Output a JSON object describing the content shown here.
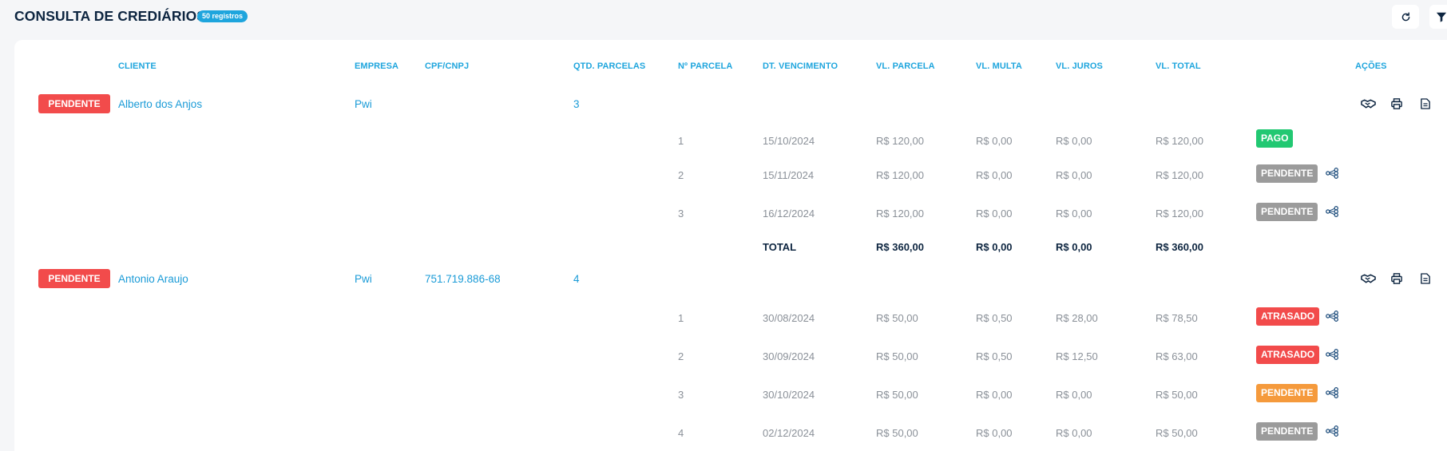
{
  "page": {
    "title": "CONSULTA DE CREDIÁRIOS",
    "records_badge": "50 registros"
  },
  "toolbar": {
    "refresh_icon": "refresh-icon",
    "filter_icon": "filter-icon"
  },
  "table": {
    "headers": {
      "cliente": "CLIENTE",
      "empresa": "EMPRESA",
      "cpf": "CPF/CNPJ",
      "qtd": "QTD. PARCELAS",
      "nparcela": "Nº PARCELA",
      "vencimento": "DT. VENCIMENTO",
      "vl_parcela": "VL. PARCELA",
      "vl_multa": "VL. MULTA",
      "vl_juros": "VL. JUROS",
      "vl_total": "VL. TOTAL",
      "acoes": "AÇÕES"
    },
    "groups": [
      {
        "status": "PENDENTE",
        "cliente": "Alberto dos Anjos",
        "empresa": "Pwi",
        "cpf": "",
        "qtd": "3",
        "parcelas": [
          {
            "n": "1",
            "vencimento": "15/10/2024",
            "vl_parcela": "R$ 120,00",
            "vl_multa": "R$ 0,00",
            "vl_juros": "R$ 0,00",
            "vl_total": "R$ 120,00",
            "status": "PAGO"
          },
          {
            "n": "2",
            "vencimento": "15/11/2024",
            "vl_parcela": "R$ 120,00",
            "vl_multa": "R$ 0,00",
            "vl_juros": "R$ 0,00",
            "vl_total": "R$ 120,00",
            "status": "PENDENTE"
          },
          {
            "n": "3",
            "vencimento": "16/12/2024",
            "vl_parcela": "R$ 120,00",
            "vl_multa": "R$ 0,00",
            "vl_juros": "R$ 0,00",
            "vl_total": "R$ 120,00",
            "status": "PENDENTE"
          }
        ],
        "total": {
          "label": "TOTAL",
          "vl_parcela": "R$ 360,00",
          "vl_multa": "R$ 0,00",
          "vl_juros": "R$ 0,00",
          "vl_total": "R$ 360,00"
        }
      },
      {
        "status": "PENDENTE",
        "cliente": "Antonio Araujo",
        "empresa": "Pwi",
        "cpf": "751.719.886-68",
        "qtd": "4",
        "parcelas": [
          {
            "n": "1",
            "vencimento": "30/08/2024",
            "vl_parcela": "R$ 50,00",
            "vl_multa": "R$ 0,50",
            "vl_juros": "R$ 28,00",
            "vl_total": "R$ 78,50",
            "status": "ATRASADO"
          },
          {
            "n": "2",
            "vencimento": "30/09/2024",
            "vl_parcela": "R$ 50,00",
            "vl_multa": "R$ 0,50",
            "vl_juros": "R$ 12,50",
            "vl_total": "R$ 63,00",
            "status": "ATRASADO"
          },
          {
            "n": "3",
            "vencimento": "30/10/2024",
            "vl_parcela": "R$ 50,00",
            "vl_multa": "R$ 0,00",
            "vl_juros": "R$ 0,00",
            "vl_total": "R$ 50,00",
            "status": "PENDENTE"
          },
          {
            "n": "4",
            "vencimento": "02/12/2024",
            "vl_parcela": "R$ 50,00",
            "vl_multa": "R$ 0,00",
            "vl_juros": "R$ 0,00",
            "vl_total": "R$ 50,00",
            "status": "PENDENTE"
          }
        ]
      }
    ]
  },
  "colors": {
    "accent": "#1ea5dd",
    "pago": "#22c872",
    "pendente_gray": "#9b9b9b",
    "pendente_orange": "#f59a3c",
    "atrasado": "#f24b4b",
    "title": "#0d2540"
  },
  "action_icons": [
    "handshake-icon",
    "printer-icon",
    "document-icon"
  ],
  "row_icon": "share-icon"
}
